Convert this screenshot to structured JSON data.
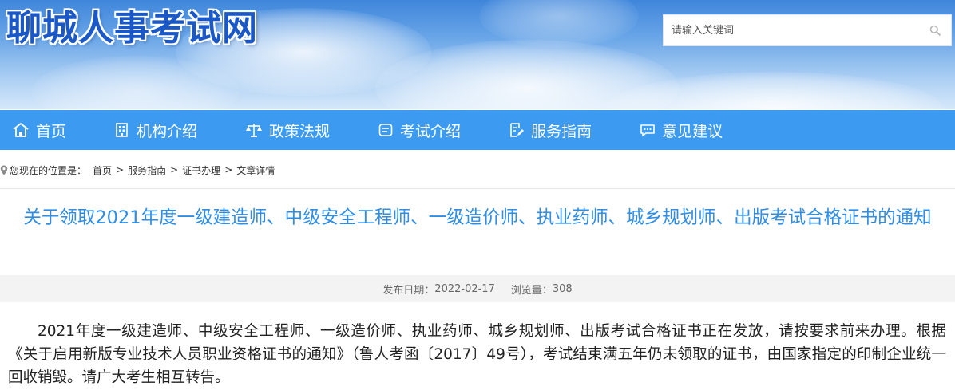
{
  "header": {
    "site_title": "聊城人事考试网",
    "search": {
      "placeholder": "请输入关键词",
      "value": "",
      "icon": "search-icon"
    }
  },
  "nav": {
    "items": [
      {
        "label": "首页",
        "icon": "home-icon"
      },
      {
        "label": "机构介绍",
        "icon": "building-icon"
      },
      {
        "label": "政策法规",
        "icon": "scales-icon"
      },
      {
        "label": "考试介绍",
        "icon": "exam-sheet-icon"
      },
      {
        "label": "服务指南",
        "icon": "guide-edit-icon"
      },
      {
        "label": "意见建议",
        "icon": "chat-bubble-icon"
      }
    ]
  },
  "breadcrumb": {
    "label": "您现在的位置是：",
    "items": [
      "首页",
      "服务指南",
      "证书办理",
      "文章详情"
    ],
    "separator": ">"
  },
  "article": {
    "title": "关于领取2021年度一级建造师、中级安全工程师、一级造价师、执业药师、城乡规划师、出版考试合格证书的通知",
    "meta": {
      "publish_label": "发布日期：",
      "publish_date": "2022-02-17",
      "views_label": "浏览量：",
      "views": "308"
    },
    "body": "2021年度一级建造师、中级安全工程师、一级造价师、执业药师、城乡规划师、出版考试合格证书正在发放，请按要求前来办理。根据《关于启用新版专业技术人员职业资格证书的通知》（鲁人考函〔2017〕49号），考试结束满五年仍未领取的证书，由国家指定的印制企业统一回收销毁。请广大考生相互转告。"
  },
  "colors": {
    "nav_bg": "#3c9bf1",
    "title_blue": "#2f8de4",
    "site_title_blue": "#1958c6"
  }
}
